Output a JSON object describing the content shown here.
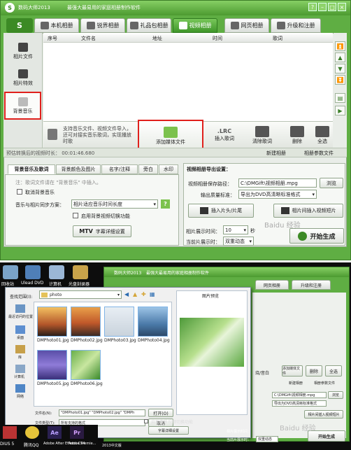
{
  "app": {
    "title": "数码大师2013",
    "slogan": "最强大最易用的家庭相册制作软件",
    "logo_letter": "S"
  },
  "window_buttons": [
    "?",
    "–",
    "□",
    "×"
  ],
  "tabs": [
    "本机相册",
    "锐界相册",
    "礼品包相册",
    "视频相册",
    "网页相册",
    "升级和注册"
  ],
  "active_tab": 3,
  "sidebar": [
    "相片文件",
    "相片特效",
    "背景音乐"
  ],
  "columns": [
    "序号",
    "文件名",
    "地址",
    "时间",
    "歌词"
  ],
  "toolbar": {
    "hint": "支持音乐文件、视频文件导入，还可对接实音乐歌词，实现播放时歌",
    "buttons": [
      "添加媒体文件",
      "插入歌词",
      "清除歌词",
      "删除",
      "全选"
    ],
    "lrc": ".LRC"
  },
  "info": {
    "duration": "预估转换后的视频时长：  00:01:46.680",
    "new": "新建相册",
    "params": "相册参数文件"
  },
  "subtabs": [
    "背景音乐及歌词",
    "背景颜色及图片",
    "名字/注释",
    "旁白",
    "水印"
  ],
  "music": {
    "note": "注：歌词文件请在 \"背景音乐\" 中插入。",
    "cancel": "取消背景音乐",
    "sync_label": "音乐与相片同步方案：",
    "sync_value": "相片适应音乐时间长度",
    "fade": "启用背景视频切换功能",
    "mtv": "字幕详细设置"
  },
  "export": {
    "header": "视频相册导出设置：",
    "path_label": "视频相册保存路径：",
    "path": "C:\\DMGift\\视频相册.mpg",
    "browse": "浏览",
    "quality_label": "输出质量标准：",
    "quality": "导出为DVD高清晰标准格式",
    "head_btn": "插入片头/片尾",
    "insert_btn": "相片间插入视频短片",
    "show_label": "相片展示时间：",
    "show_value": "10",
    "sec": "秒",
    "effect_label": "当前片展示时：",
    "effect_value": "双重动态",
    "start": "开始生成"
  },
  "watermark": "Baidu 经验",
  "desktop": {
    "icons": [
      "回收站",
      "Ulead DVD",
      "计算机",
      "光盘刻录器"
    ],
    "taskbar": [
      "DIUS 5",
      "腾讯QQ",
      "Adobe After Effects CS4",
      "Adobe Premie...",
      "2013中文版"
    ]
  },
  "dialog": {
    "lookin_label": "查找范围(I):",
    "folder": "photo",
    "places": [
      "最近访问的位置",
      "桌面",
      "库",
      "计算机",
      "网络"
    ],
    "files": [
      "DMPhoto01.jpg",
      "DMPhoto02.jpg",
      "DMPhoto03.jpg",
      "DMPhoto04.jpg",
      "DMPhoto05.jpg",
      "DMPhoto06.jpg"
    ],
    "preview_label": "图片预览",
    "name_label": "文件名(N):",
    "name_value": "\"DMPhoto01.jpg\" \"DMPhoto02.jpg\" \"DMPh",
    "type_label": "文件类型(T):",
    "type_value": "所有支持的格式",
    "open": "打开(O)",
    "cancel": "取消"
  },
  "bg_right": {
    "web": "网页相册",
    "reg": "升级和注册",
    "path": "C:\\DMGift\\视频相册.mpg",
    "quality": "导出为DVD高清晰标准格式",
    "browse": "浏览",
    "insert_btn": "相片间插入视频短片",
    "effect": "双重动态",
    "fade": "启用背景视频切换功能",
    "mtv": "字幕详细设置",
    "new": "新建相册",
    "params": "相册参数文件",
    "show_label": "相片展示时间：",
    "effect_label": "当前片展示时：",
    "del": "删除",
    "all": "全选",
    "add": "添加媒体文件",
    "head": "插入片头/片尾",
    "side": "烧/音白",
    "start": "开始生成"
  },
  "colors": {
    "green": "#5fae43",
    "red": "#e0201c"
  }
}
